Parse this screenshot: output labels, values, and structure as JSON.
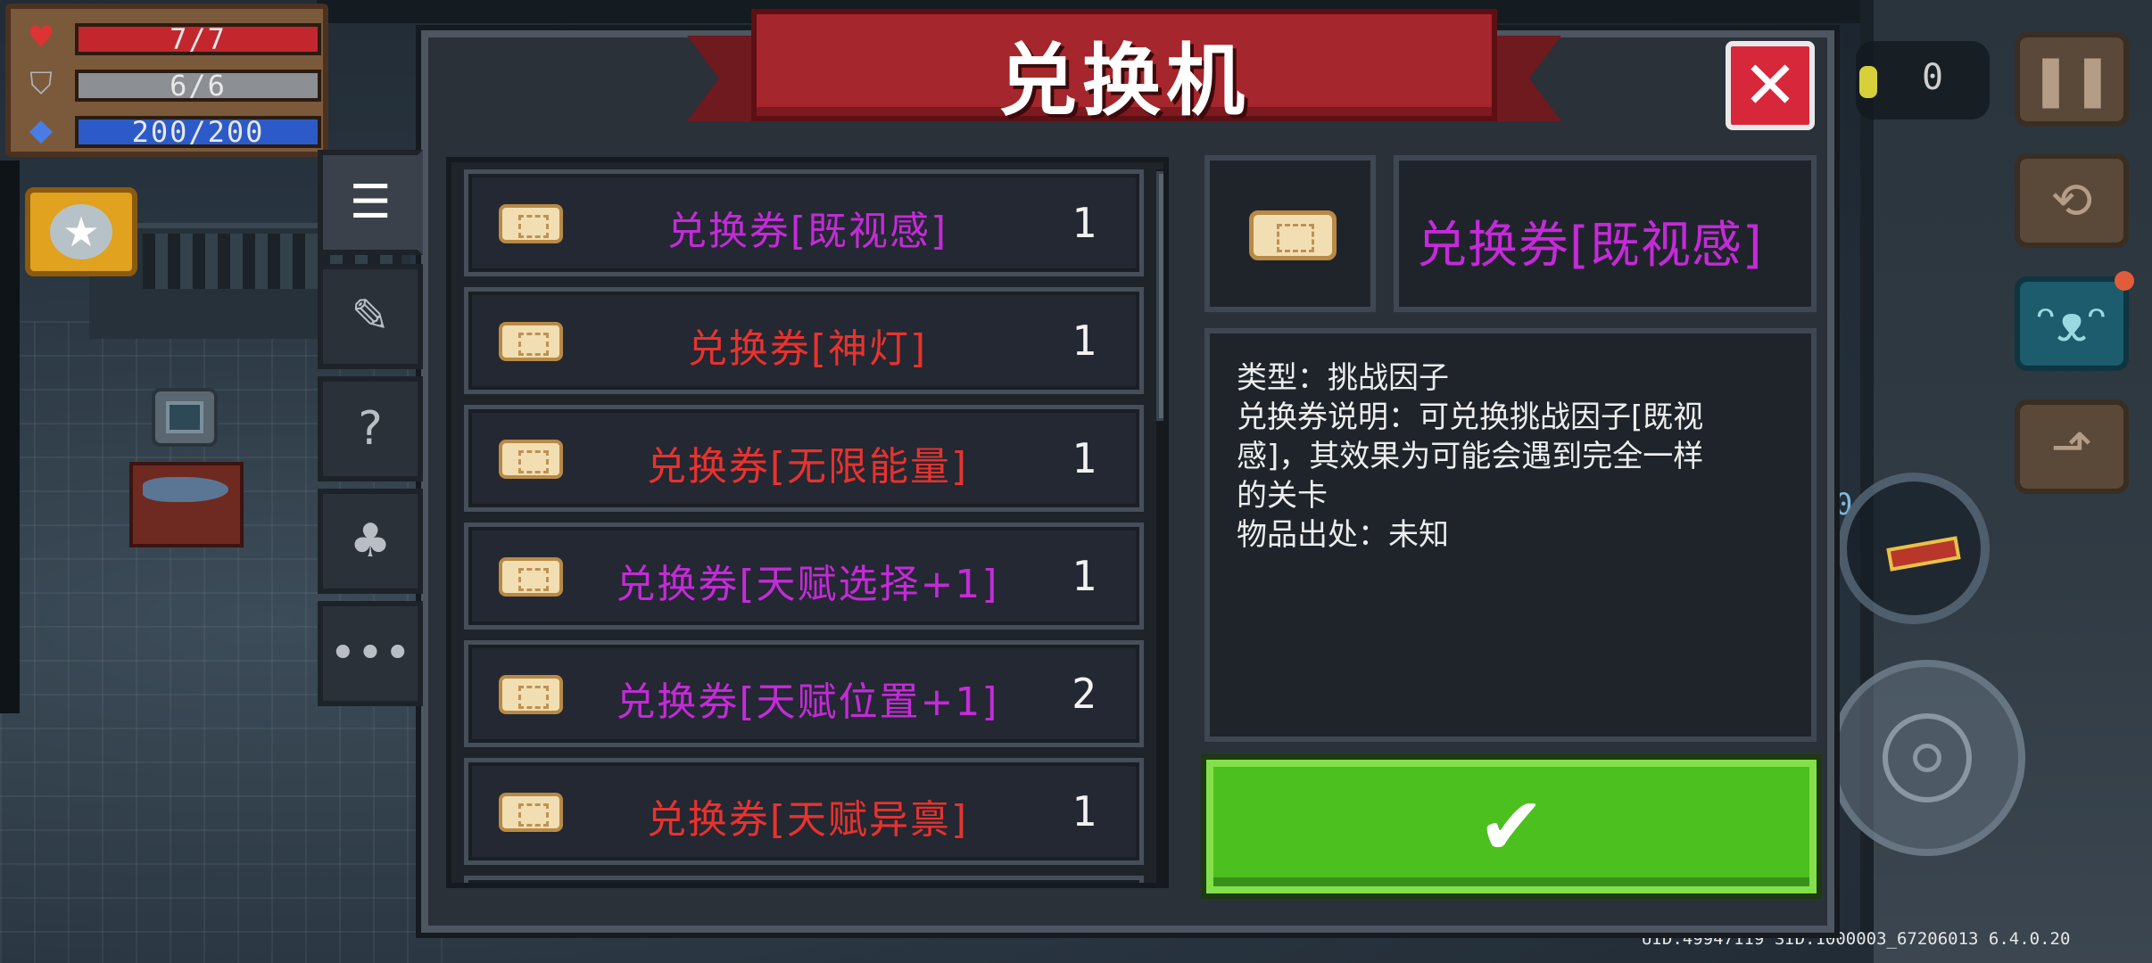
{
  "hud": {
    "hp": "7/7",
    "armor": "6/6",
    "energy": "200/200"
  },
  "currency": {
    "gems": "0"
  },
  "dialog": {
    "title": "兑换机",
    "close_label": "✕",
    "confirm_label": "✔",
    "tabs": [
      {
        "name": "list-icon",
        "glyph": "☰"
      },
      {
        "name": "weapon-icon",
        "glyph": "✎"
      },
      {
        "name": "unknown-icon",
        "glyph": "?"
      },
      {
        "name": "plant-icon",
        "glyph": "♣"
      },
      {
        "name": "more-icon",
        "glyph": "•••"
      }
    ],
    "items": [
      {
        "name": "兑换券[既视感]",
        "qty": "1",
        "color": "#c52ad9"
      },
      {
        "name": "兑换券[神灯]",
        "qty": "1",
        "color": "#e8322e"
      },
      {
        "name": "兑换券[无限能量]",
        "qty": "1",
        "color": "#e8322e"
      },
      {
        "name": "兑换券[天赋选择+1]",
        "qty": "1",
        "color": "#c52ad9"
      },
      {
        "name": "兑换券[天赋位置+1]",
        "qty": "2",
        "color": "#c52ad9"
      },
      {
        "name": "兑换券[天赋异禀]",
        "qty": "1",
        "color": "#e8322e"
      }
    ],
    "detail": {
      "name": "兑换券[既视感]",
      "lines": [
        "类型：挑战因子",
        "兑换券说明：可兑换挑战因子[既视",
        "感]，其效果为可能会遇到完全一样",
        "的关卡",
        "物品出处：未知"
      ]
    }
  },
  "version_info": "UID:49947119 SID:1000003_67206013 6.4.0.20",
  "weapon_ammo": "0"
}
